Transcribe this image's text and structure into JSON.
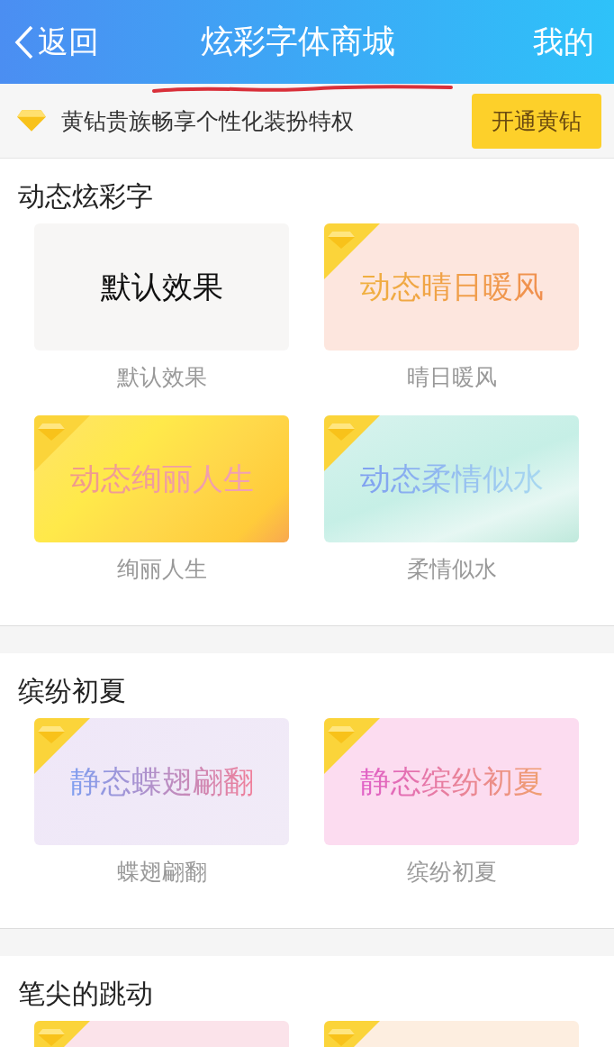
{
  "header": {
    "back": "返回",
    "title": "炫彩字体商城",
    "right": "我的"
  },
  "banner": {
    "text": "黄钻贵族畅享个性化装扮特权",
    "button": "开通黄钻"
  },
  "sections": [
    {
      "title": "动态炫彩字",
      "tiles": [
        {
          "kind": "plain",
          "vip": false,
          "preview": "默认效果",
          "label": "默认效果"
        },
        {
          "kind": "peach",
          "vip": true,
          "preview": "动态晴日暖风",
          "label": "晴日暖风"
        },
        {
          "kind": "gold",
          "vip": true,
          "preview": "动态绚丽人生",
          "label": "绚丽人生"
        },
        {
          "kind": "aqua",
          "vip": true,
          "preview": "动态柔情似水",
          "label": "柔情似水"
        }
      ]
    },
    {
      "title": "缤纷初夏",
      "tiles": [
        {
          "kind": "lavender",
          "vip": true,
          "preview": "静态蝶翅翩翻",
          "label": "蝶翅翩翻"
        },
        {
          "kind": "pink",
          "vip": true,
          "preview": "静态缤纷初夏",
          "label": "缤纷初夏"
        }
      ]
    },
    {
      "title": "笔尖的跳动",
      "tiles": [
        {
          "kind": "rose",
          "vip": true
        },
        {
          "kind": "cream",
          "vip": true
        }
      ]
    }
  ]
}
